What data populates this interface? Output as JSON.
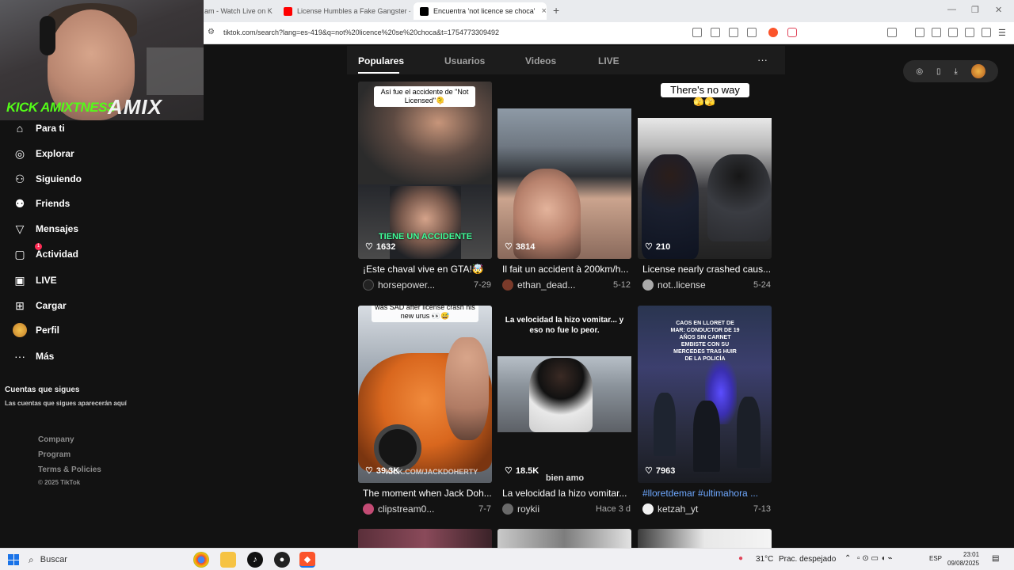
{
  "browser": {
    "tabs": [
      {
        "label": "am - Watch Live on K"
      },
      {
        "label": "License Humbles a Fake Gangster - Y"
      },
      {
        "label": "Encuentra 'not licence se choca'"
      }
    ],
    "new_tab": "+",
    "url": "tiktok.com/search?lang=es-419&q=not%20licence%20se%20choca&t=1754773309492"
  },
  "stream_overlay": {
    "kick_text": "KICK AMIXTNESS",
    "brand_text": "AMIX"
  },
  "sidebar": {
    "items": [
      {
        "label": "Para ti",
        "icon": "home-icon"
      },
      {
        "label": "Explorar",
        "icon": "compass-icon"
      },
      {
        "label": "Siguiendo",
        "icon": "following-icon"
      },
      {
        "label": "Friends",
        "icon": "friends-icon"
      },
      {
        "label": "Mensajes",
        "icon": "send-icon"
      },
      {
        "label": "Actividad",
        "icon": "activity-icon",
        "badge": "1"
      },
      {
        "label": "LIVE",
        "icon": "live-icon"
      },
      {
        "label": "Cargar",
        "icon": "upload-icon"
      },
      {
        "label": "Perfil",
        "icon": "avatar"
      },
      {
        "label": "Más",
        "icon": "more-icon"
      }
    ],
    "following_heading": "Cuentas que sigues",
    "following_sub": "Las cuentas que sigues aparecerán aquí",
    "footer": {
      "links": [
        "Company",
        "Program",
        "Terms & Policies"
      ],
      "copyright": "© 2025 TikTok"
    }
  },
  "search_tabs": {
    "tabs": [
      "Populares",
      "Usuarios",
      "Videos",
      "LIVE"
    ],
    "more": "···"
  },
  "videos": [
    {
      "likes": "1632",
      "title": "¡Este chaval vive en GTA!🤯",
      "author": "horsepower...",
      "date": "7-29",
      "caption": "Así fue el accidente de \"Not Licensed\"🫠",
      "overlay": "TIENE UN ACCIDENTE"
    },
    {
      "likes": "3814",
      "title": "Il fait un accident à 200km/h...",
      "author": "ethan_dead...",
      "date": "5-12"
    },
    {
      "likes": "210",
      "title": "License nearly crashed caus...",
      "author": "not..license",
      "date": "5-24",
      "caption": "There's no way",
      "caption_emoji": "🫣🫣"
    },
    {
      "likes": "39.3K",
      "title": "The moment when Jack Doh...",
      "author": "clipstream0...",
      "date": "7-7",
      "caption": "was SAD after license crash his new urus 👀😅",
      "watermark": "KICK.COM/JACKDOHERTY"
    },
    {
      "likes": "18.5K",
      "title": "La velocidad la hizo vomitar...",
      "author": "roykii",
      "date": "Hace 3 d",
      "overlay": "La velocidad la hizo vomitar... y eso no fue lo peor.",
      "overlay_bottom": "bien amo"
    },
    {
      "likes": "7963",
      "title": "#lloretdemar #ultimahora ...",
      "author": "ketzah_yt",
      "date": "7-13",
      "overlay": "CAOS EN LLORET DE MAR: CONDUCTOR DE 19 AÑOS SIN CARNET EMBISTE CON SU MERCEDES TRAS HUIR DE LA POLICÍA"
    }
  ],
  "taskbar": {
    "search": "Buscar",
    "weather": "31°C",
    "weather_desc": "Prac. despejado",
    "lang": "ESP",
    "time": "23:01",
    "date": "09/08/2025"
  },
  "colors": {
    "background": "#121212",
    "accent": "#fe2c55",
    "kick_green": "#53fc18",
    "hashtag_blue": "#6ea8ff"
  }
}
